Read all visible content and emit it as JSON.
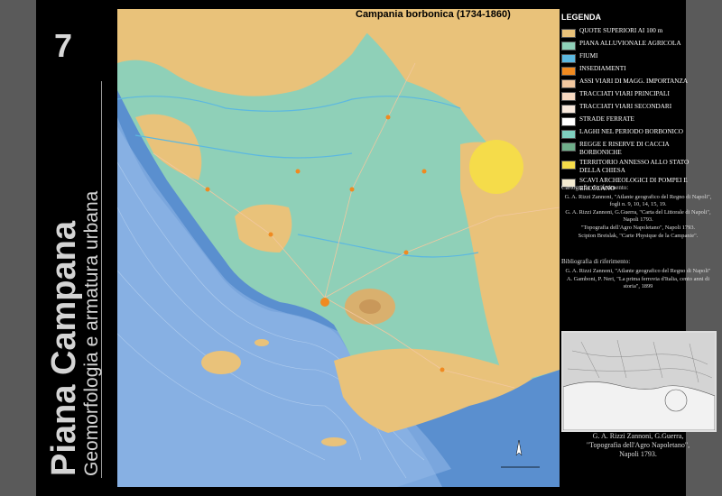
{
  "side": {
    "page_number": "7",
    "title": "Piana Campana",
    "subtitle": "Geomorfologia e armatura urbana"
  },
  "map": {
    "title": "Campania borbonica (1734-1860)",
    "colors": {
      "sea_deep": "#5a8fcf",
      "sea_shallow": "#8fb6e6",
      "plain": "#8fd0b8",
      "hills": "#e9c27a",
      "river": "#5cb8e0",
      "settlement": "#f08a20",
      "papal": "#f5dc4a"
    }
  },
  "legend": {
    "heading": "LEGENDA",
    "items": [
      {
        "label": "QUOTE SUPERIORI AI 100 m",
        "color": "#e9c27a"
      },
      {
        "label": "PIANA ALLUVIONALE AGRICOLA",
        "color": "#8fd0b8"
      },
      {
        "label": "FIUMI",
        "color": "#5cb8e0"
      },
      {
        "label": "INSEDIAMENTI",
        "color": "#f08a20"
      },
      {
        "label": "ASSI VIARI DI MAGG. IMPORTANZA",
        "color": "#f2c8a0"
      },
      {
        "label": "TRACCIATI VIARI PRINCIPALI",
        "color": "#f6d8c0"
      },
      {
        "label": "TRACCIATI VIARI SECONDARI",
        "color": "#f8e8dc"
      },
      {
        "label": "STRADE FERRATE",
        "color": "#ffffff"
      },
      {
        "label": "LAGHI NEL PERIODO BORBONICO",
        "color": "#7fd0c0"
      },
      {
        "label": "REGGE E RISERVE DI CACCIA BORBONICHE",
        "color": "#6fae8a"
      },
      {
        "label": "TERRITORIO ANNESSO ALLO STATO DELLA CHIESA",
        "color": "#f5dc4a"
      },
      {
        "label": "SCAVI ARCHEOLOGICI DI POMPEI E ERCOLANO",
        "color": "#f3ead0"
      }
    ]
  },
  "cartography": {
    "heading": "Cartografia di riferimento:",
    "lines": [
      "G. A. Rizzi Zannoni, \"Atlante geografico del Regno di Napoli\", fogli n. 9, 10, 14, 15, 19.",
      "G. A. Rizzi Zannoni, G.Guerra, \"Carta del Littorale di Napoli\", Napoli 1793.",
      "\"Topografia dell'Agro Napoletano\", Napoli 1793.",
      "Scipion Breislak, \"Carte Physique de la Campanie\"."
    ]
  },
  "bibliography": {
    "heading": "Bibliografia di riferimento:",
    "lines": [
      "G. A. Rizzi Zannoni, \"Atlante geografico del Regno di Napoli\"",
      "A. Gamboni, P. Neri, \"La prima ferrovia d'Italia, cento anni di storia\", 1899"
    ]
  },
  "inset": {
    "caption_lines": [
      "G. A. Rizzi Zannoni, G.Guerra,",
      "\"Topografia dell'Agro Napoletano\",",
      "Napoli 1793."
    ]
  }
}
